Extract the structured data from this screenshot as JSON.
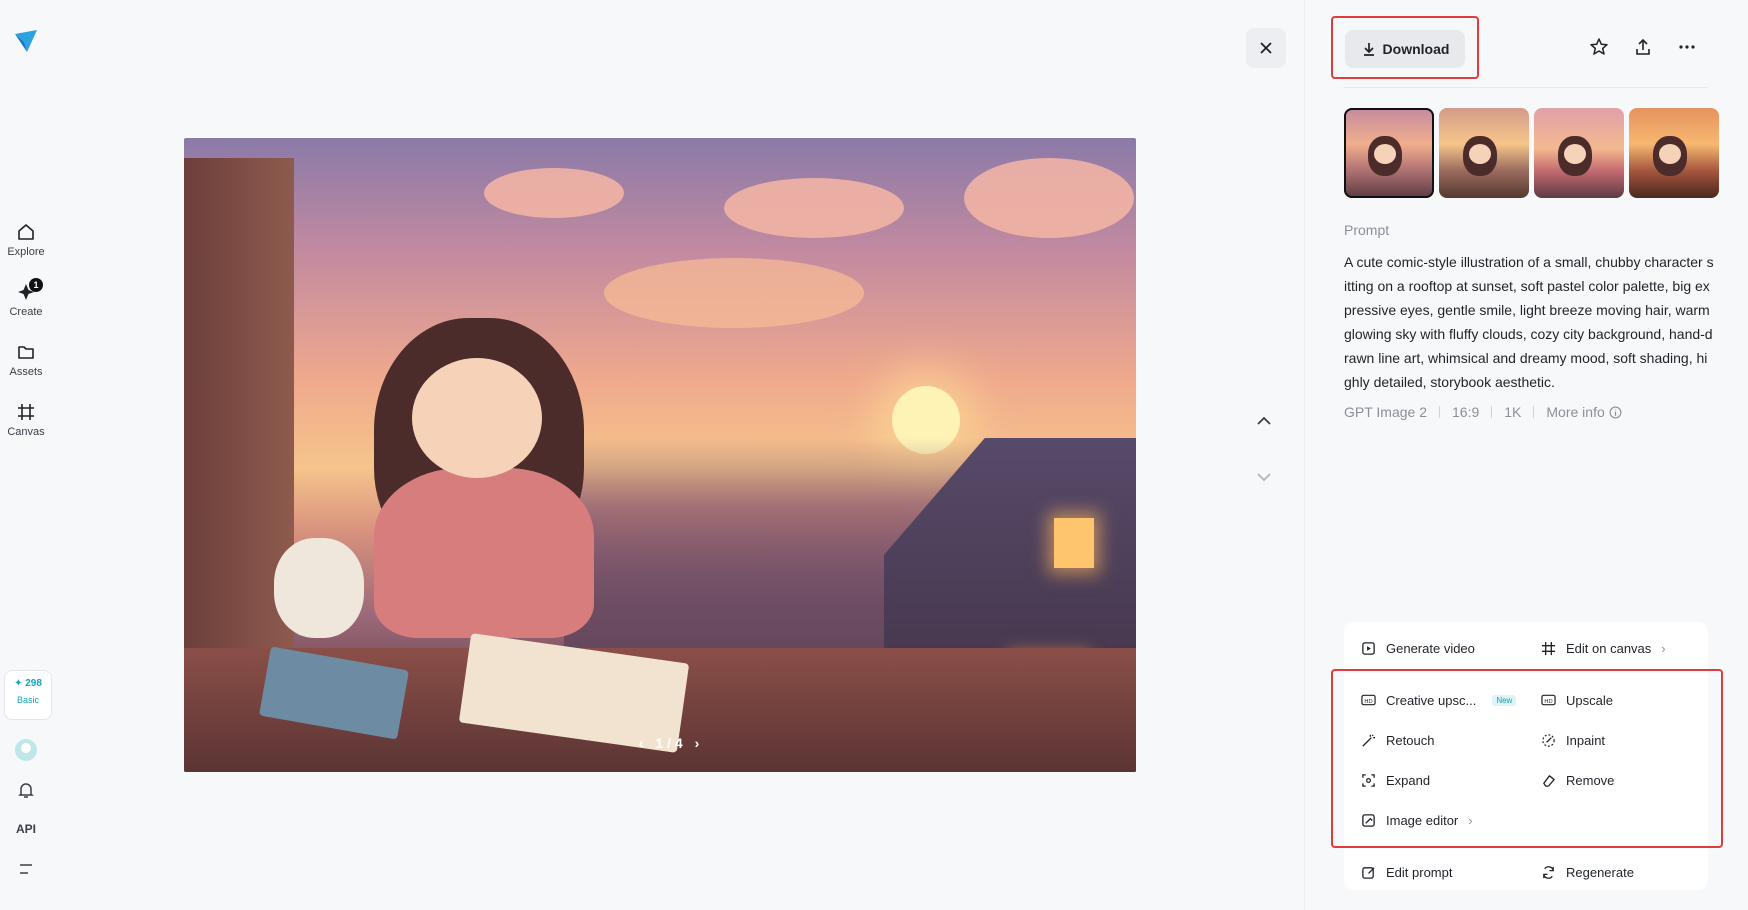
{
  "sidebar": {
    "items": [
      {
        "label": "Explore",
        "icon": "home-icon"
      },
      {
        "label": "Create",
        "icon": "create-icon",
        "badge": "1"
      },
      {
        "label": "Assets",
        "icon": "folder-icon"
      },
      {
        "label": "Canvas",
        "icon": "canvas-icon"
      }
    ],
    "credits": {
      "amount": "✦ 298",
      "plan": "Basic"
    },
    "api_label": "API"
  },
  "viewer": {
    "pager": {
      "current_text": "1 / 4"
    }
  },
  "toolbar": {
    "download_label": "Download"
  },
  "prompt": {
    "title": "Prompt",
    "text": "A cute comic-style illustration of a small, chubby character sitting on a rooftop at sunset, soft pastel color palette, big expressive eyes, gentle smile, light breeze moving hair, warm glowing sky with fluffy clouds, cozy city background, hand-drawn line art, whimsical and dreamy mood, soft shading, highly detailed, storybook aesthetic.",
    "model": "GPT Image 2",
    "ratio": "16:9",
    "resolution": "1K",
    "more_info": "More info"
  },
  "actions": {
    "generate_video": "Generate video",
    "edit_on_canvas": "Edit on canvas",
    "creative_upscale": "Creative upsc...",
    "new_tag": "New",
    "upscale": "Upscale",
    "retouch": "Retouch",
    "inpaint": "Inpaint",
    "expand": "Expand",
    "remove": "Remove",
    "image_editor": "Image editor",
    "edit_prompt": "Edit prompt",
    "regenerate": "Regenerate"
  },
  "colors": {
    "accent": "#13a5b8",
    "highlight": "#e03c3c"
  }
}
